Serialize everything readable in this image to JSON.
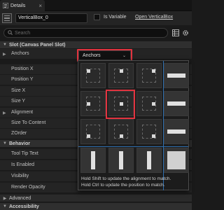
{
  "tab": {
    "label": "Details",
    "close": "×"
  },
  "header": {
    "name_value": "VerticalBox_0",
    "is_variable_label": "Is Variable",
    "open_link": "Open VerticalBox"
  },
  "search": {
    "placeholder": "Search"
  },
  "sections": {
    "slot": "Slot (Canvas Panel Slot)",
    "behavior": "Behavior",
    "advanced": "Advanced",
    "accessibility": "Accessibility"
  },
  "slot_rows": [
    "Anchors",
    "Position X",
    "Position Y",
    "Size X",
    "Size Y",
    "Alignment",
    "Size To Content",
    "ZOrder"
  ],
  "behavior_rows": [
    "Tool Tip Text",
    "Is Enabled",
    "Visibility",
    "Render Opacity"
  ],
  "anchors_combo": {
    "label": "Anchors"
  },
  "anchor_popup": {
    "hint_shift": "Hold Shift to update the alignment to match.",
    "hint_ctrl": "Hold Ctrl to update the position to match."
  },
  "colors": {
    "highlight": "#e2333f",
    "separator": "#2f6fb0",
    "panel": "#242424"
  },
  "icons": [
    "details-tab-icon",
    "widget-icon",
    "search-icon",
    "grid-view-icon",
    "settings-gear-icon",
    "dropdown-arrow-icon",
    "anchor-preset-icons"
  ]
}
